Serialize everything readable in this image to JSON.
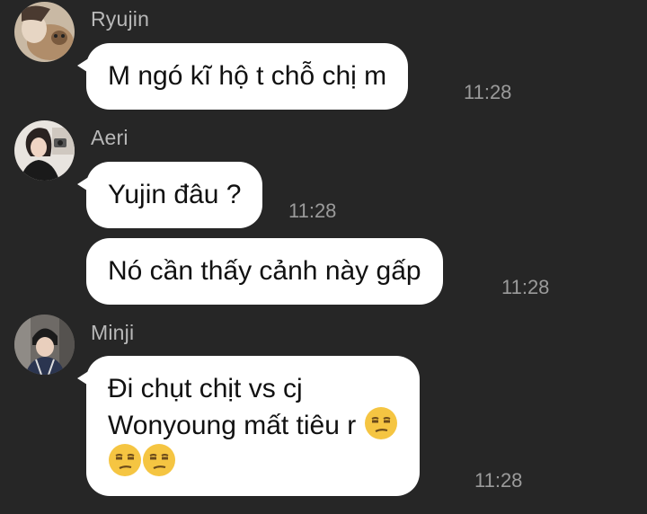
{
  "messages": [
    {
      "sender": "Ryujin",
      "text": "M ngó kĩ hộ t chỗ chị m",
      "time": "11:28"
    },
    {
      "sender": "Aeri",
      "text": "Yujin đâu ?",
      "time": "11:28"
    },
    {
      "sender": "",
      "text": "Nó cần thấy cảnh này gấp",
      "time": "11:28"
    },
    {
      "sender": "Minji",
      "line1": "Đi chụt chịt vs cj",
      "line2": "Wonyoung mất tiêu r",
      "time": "11:28",
      "emojis": [
        "unamused-face-emoji",
        "unamused-face-emoji",
        "unamused-face-emoji"
      ]
    }
  ],
  "colors": {
    "background": "#262626",
    "bubble": "#ffffff",
    "name_text": "#b8b8b8",
    "time_text": "#9b9b9b",
    "emoji": "#f5c542"
  }
}
